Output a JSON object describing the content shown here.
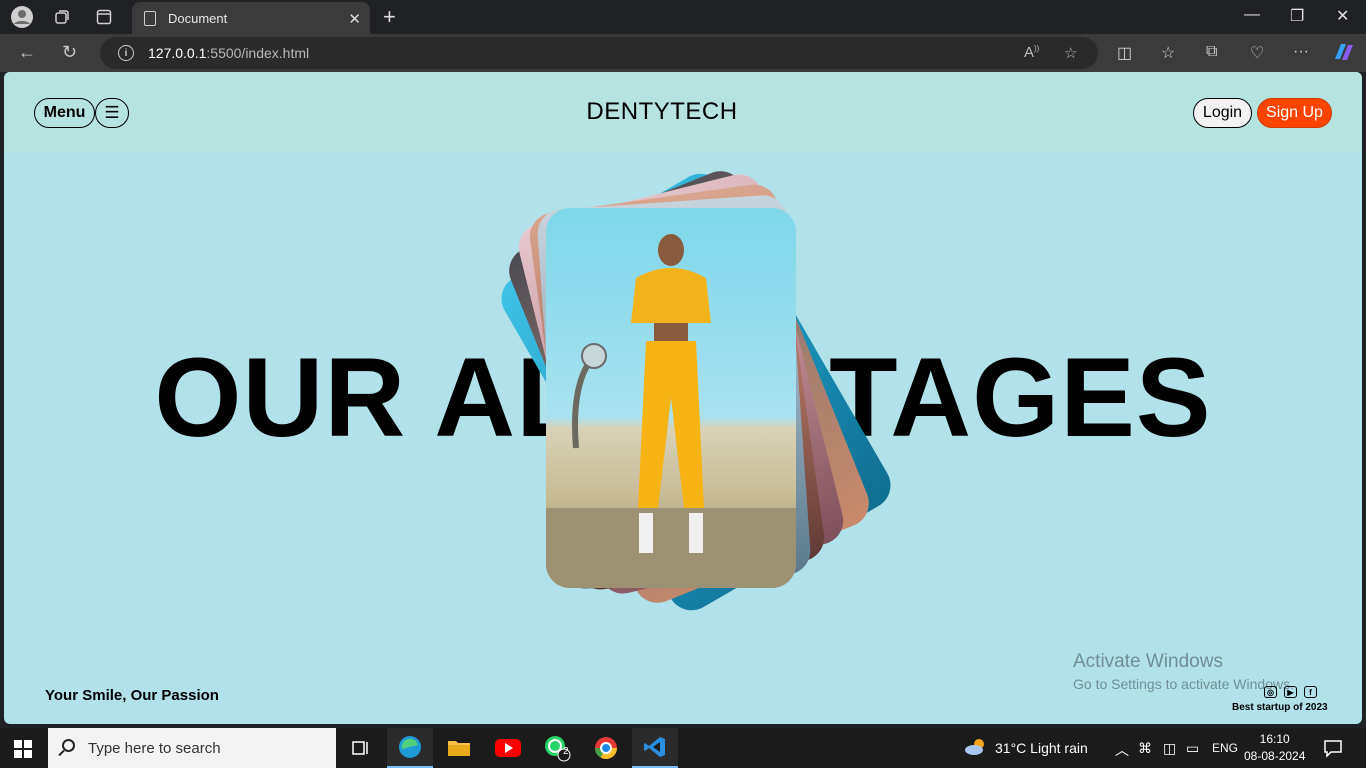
{
  "browser": {
    "tab_title": "Document",
    "url_host": "127.0.0.1",
    "url_path": ":5500/index.html",
    "icons": [
      "profile-icon",
      "workspaces-icon",
      "tab-actions-icon",
      "document-icon",
      "close-icon",
      "new-tab-icon",
      "minimize-icon",
      "restore-icon",
      "window-close-icon",
      "back-icon",
      "refresh-icon",
      "info-icon",
      "read-aloud-icon",
      "favorite-icon",
      "split-screen-icon",
      "favorites-icon",
      "collections-icon",
      "performance-icon",
      "more-icon",
      "copilot-icon"
    ]
  },
  "page": {
    "menu_label": "Menu",
    "hamburger": "☰",
    "brand": "DENTYTECH",
    "login_label": "Login",
    "signup_label": "Sign Up",
    "hero_title": "OUR ADVANTAGES",
    "tagline": "Your Smile, Our Passion",
    "award": "Best startup of 2023",
    "social_icons": [
      "instagram-icon",
      "youtube-icon",
      "facebook-icon"
    ],
    "colors": {
      "page_bg": "#b1e2ea",
      "header_bg": "#b5e3df",
      "signup_bg": "#ff4400"
    }
  },
  "watermark": {
    "line1": "Activate Windows",
    "line2": "Go to Settings to activate Windows."
  },
  "taskbar": {
    "search_placeholder": "Type here to search",
    "weather": "31°C  Light rain",
    "lang": "ENG",
    "time": "16:10",
    "date": "08-08-2024",
    "whatsapp_badge": "2"
  }
}
